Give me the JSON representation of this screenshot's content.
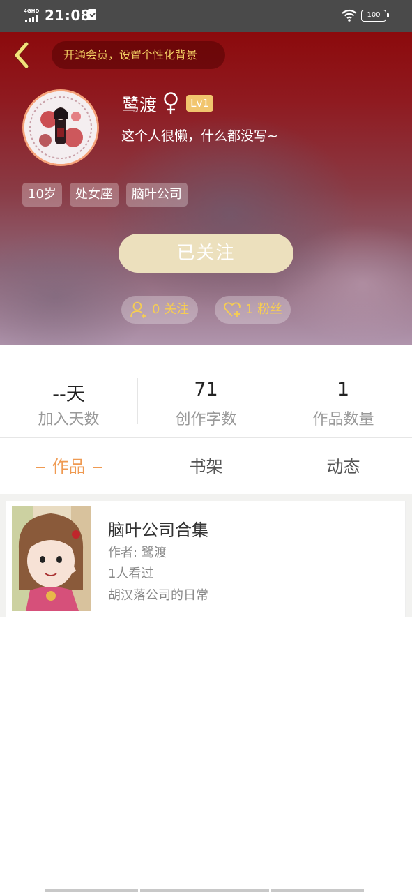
{
  "status_bar": {
    "network": "4GHD",
    "time": "21:08",
    "battery": "100"
  },
  "header": {
    "vip_promo": "开通会员，设置个性化背景",
    "user_name": "鹭渡",
    "level": "Lv1",
    "bio": "这个人很懒，什么都没写~",
    "tags": [
      "10岁",
      "处女座",
      "脑叶公司"
    ],
    "follow_button": "已关注",
    "following_count": "0",
    "following_label": "关注",
    "fans_count": "1",
    "fans_label": "粉丝",
    "colors": {
      "vip_text": "#f2cd62",
      "level_badge": "#f1c56e",
      "follow_button_bg": "#ece0bd",
      "stat_text": "#f6cd52"
    }
  },
  "stats": [
    {
      "value": "--天",
      "label": "加入天数"
    },
    {
      "value": "71",
      "label": "创作字数"
    },
    {
      "value": "1",
      "label": "作品数量"
    }
  ],
  "tabs": {
    "items": [
      "作品",
      "书架",
      "动态"
    ],
    "active": "作品",
    "active_color": "#ef9a52"
  },
  "works": [
    {
      "title": "脑叶公司合集",
      "author": "作者: 鹭渡",
      "views": "1人看过",
      "description": "胡汉落公司的日常"
    }
  ],
  "icons": [
    "back-arrow-icon",
    "female-icon",
    "add-user-icon",
    "heart-plus-icon",
    "wifi-icon",
    "battery-icon",
    "signal-icon",
    "clipboard-check-icon"
  ]
}
